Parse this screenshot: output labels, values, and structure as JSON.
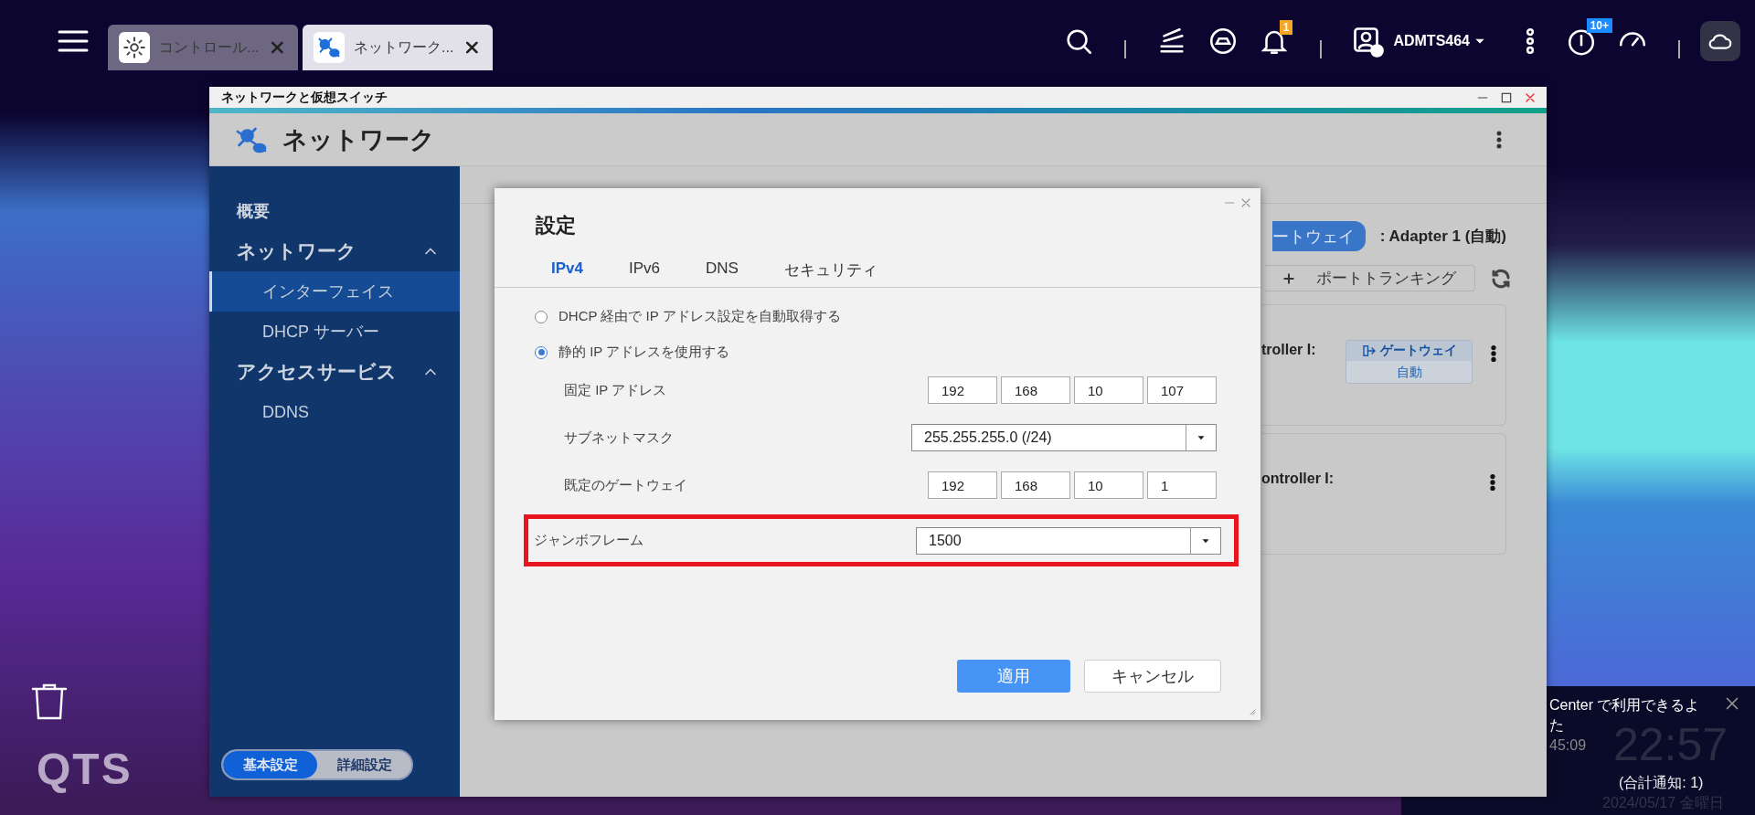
{
  "taskbar": {
    "tabs": [
      {
        "label": "コントロール...",
        "selected": false
      },
      {
        "label": "ネットワーク...",
        "selected": true
      }
    ],
    "notification_badge": "1",
    "user": "ADMTS464",
    "update_badge": "10+"
  },
  "window": {
    "title": "ネットワークと仮想スイッチ",
    "app_title": "ネットワーク",
    "sidebar": {
      "items": [
        {
          "label": "概要",
          "selected": false
        },
        {
          "label": "ネットワーク",
          "selected": false,
          "expanded": true,
          "children": [
            {
              "label": "インターフェイス",
              "selected": true
            },
            {
              "label": "DHCP サーバー",
              "selected": false
            }
          ]
        },
        {
          "label": "アクセスサービス",
          "selected": false,
          "expanded": true,
          "children": [
            {
              "label": "DDNS",
              "selected": false
            }
          ]
        }
      ]
    },
    "mode_toggle": [
      {
        "label": "基本設定",
        "selected": true
      },
      {
        "label": "詳細設定",
        "selected": false
      }
    ],
    "background_panel": {
      "gateway_button": "ートウェイ",
      "adapter_label": ": Adapter 1 (自動)",
      "trunking_button": "ポートトランキング",
      "cards": [
        {
          "label": "troller I:",
          "badge": {
            "title": "ゲートウェイ",
            "subtitle": "自動"
          }
        },
        {
          "label": "ontroller I:"
        }
      ]
    }
  },
  "dialog": {
    "title": "設定",
    "tabs": [
      {
        "label": "IPv4",
        "selected": true
      },
      {
        "label": "IPv6",
        "selected": false
      },
      {
        "label": "DNS",
        "selected": false
      },
      {
        "label": "セキュリティ",
        "selected": false
      }
    ],
    "options": [
      {
        "label": "DHCP 経由で IP アドレス設定を自動取得する",
        "selected": false
      },
      {
        "label": "静的 IP アドレスを使用する",
        "selected": true
      }
    ],
    "fields": [
      {
        "kind": "ip",
        "label": "固定 IP アドレス",
        "octets": [
          "192",
          "168",
          "10",
          "107"
        ],
        "highlighted": false
      },
      {
        "kind": "select",
        "label": "サブネットマスク",
        "value": "255.255.255.0 (/24)",
        "highlighted": false
      },
      {
        "kind": "ip",
        "label": "既定のゲートウェイ",
        "octets": [
          "192",
          "168",
          "10",
          "1"
        ],
        "highlighted": false
      },
      {
        "kind": "select",
        "label": "ジャンボフレーム",
        "value": "1500",
        "highlighted": true
      }
    ],
    "buttons": [
      {
        "label": "適用",
        "kind": "primary"
      },
      {
        "label": "キャンセル",
        "kind": "secondary"
      }
    ]
  },
  "notification": {
    "lines": [
      "Center で利用できるよ",
      "た"
    ],
    "time": "45:09",
    "clock": "22:57",
    "date": "2024/05/17 金曜日",
    "total": "(合計通知: 1)"
  },
  "desktop": {
    "logo": "QTS"
  }
}
